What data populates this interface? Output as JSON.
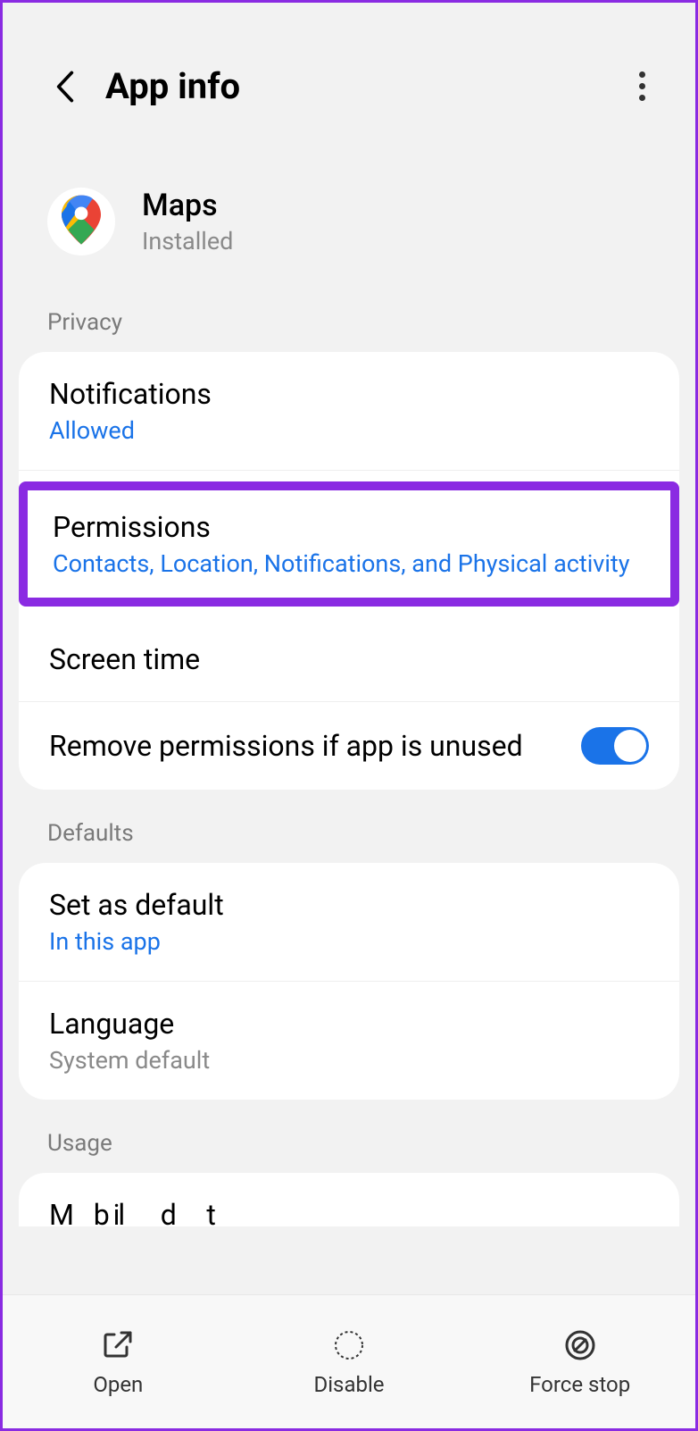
{
  "header": {
    "title": "App info"
  },
  "app": {
    "name": "Maps",
    "status": "Installed"
  },
  "sections": {
    "privacy": {
      "header": "Privacy",
      "notifications": {
        "title": "Notifications",
        "subtitle": "Allowed"
      },
      "permissions": {
        "title": "Permissions",
        "subtitle": "Contacts, Location, Notifications, and Physical activity"
      },
      "screentime": {
        "title": "Screen time"
      },
      "removeperms": {
        "title": "Remove permissions if app is unused",
        "toggled": true
      }
    },
    "defaults": {
      "header": "Defaults",
      "setdefault": {
        "title": "Set as default",
        "subtitle": "In this app"
      },
      "language": {
        "title": "Language",
        "subtitle": "System default"
      }
    },
    "usage": {
      "header": "Usage",
      "partial": "M    b  il       d      t"
    }
  },
  "bottombar": {
    "open": "Open",
    "disable": "Disable",
    "forcestop": "Force stop"
  }
}
